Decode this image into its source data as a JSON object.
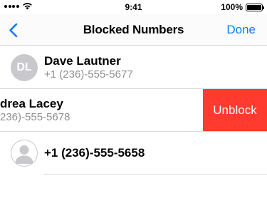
{
  "status_bar": {
    "time": "9:41",
    "battery_percent": "100%",
    "battery_level": 1.0,
    "icons": [
      "signal-icon",
      "wifi-icon",
      "battery-icon"
    ]
  },
  "nav": {
    "title": "Blocked Numbers",
    "done_label": "Done",
    "back_icon": "chevron-left-icon",
    "accent_color": "#0a7aff"
  },
  "contacts": [
    {
      "initials": "DL",
      "name": "Dave Lautner",
      "phone": "+1 (236)-555-5677"
    },
    {
      "name": "drea Lacey",
      "phone": "236)-555-5678",
      "action_label": "Unblock",
      "action_color": "#ff3b30"
    },
    {
      "name": "+1 (236)-555-5658",
      "avatar_icon": "person-silhouette-icon"
    }
  ]
}
